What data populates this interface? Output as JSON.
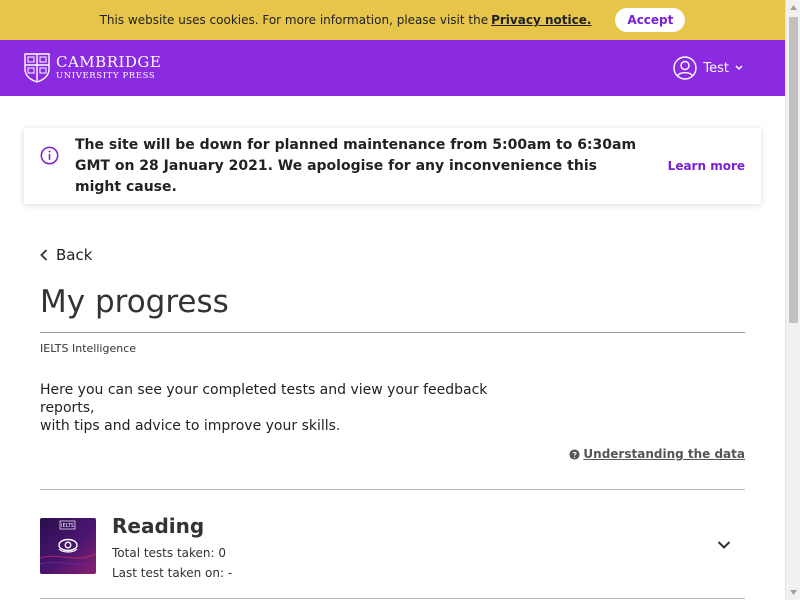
{
  "cookie": {
    "text": "This website uses cookies. For more information, please visit the",
    "link": "Privacy notice.",
    "accept": "Accept"
  },
  "header": {
    "logo_top": "CAMBRIDGE",
    "logo_bottom": "UNIVERSITY PRESS",
    "user_name": "Test"
  },
  "notice": {
    "text": "The site will be down for planned maintenance from 5:00am to 6:30am GMT on 28 January 2021. We apologise for any inconvenience this might cause.",
    "learn_more": "Learn more",
    "icon": "info-icon"
  },
  "page": {
    "back": "Back",
    "title": "My progress",
    "subtitle": "IELTS Intelligence",
    "intro_line1": "Here you can see your completed tests and view your feedback reports,",
    "intro_line2": "with tips and advice to improve your skills.",
    "understanding": "Understanding the data"
  },
  "skills": [
    {
      "name": "Reading",
      "badge": "IELTS",
      "total_tests": "Total tests taken: 0",
      "last_test": "Last test taken on: -"
    }
  ],
  "colors": {
    "cookie_bg": "#e6c54a",
    "brand_purple": "#8a2be2",
    "accent": "#7a1fd6"
  }
}
